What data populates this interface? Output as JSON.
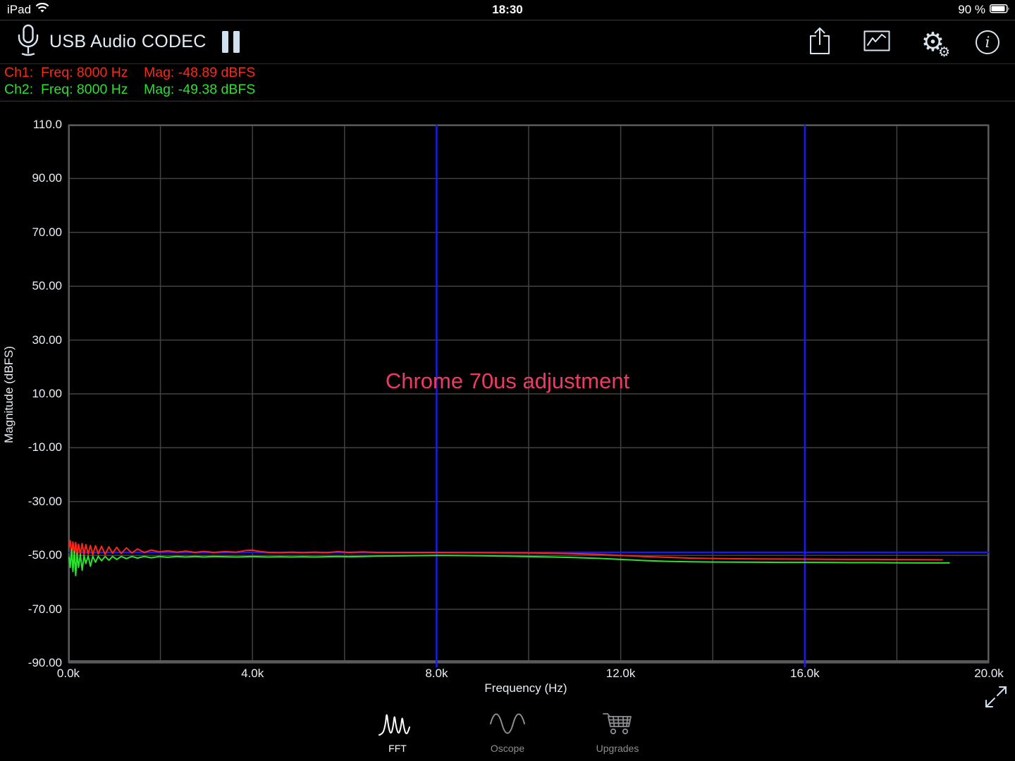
{
  "status_bar": {
    "carrier": "iPad",
    "time": "18:30",
    "battery": "90 %"
  },
  "toolbar": {
    "title": "USB Audio CODEC",
    "input_icon": "microphone-icon",
    "pause_icon": "pause-icon",
    "action_icons": [
      "share-icon",
      "chart-icon",
      "settings-gear-icon",
      "info-icon"
    ]
  },
  "readouts": [
    {
      "channel": "Ch1:",
      "freq": "Freq: 8000 Hz",
      "mag": "Mag: -48.89 dBFS",
      "color": "#fb271b"
    },
    {
      "channel": "Ch2:",
      "freq": "Freq: 8000 Hz",
      "mag": "Mag: -49.38 dBFS",
      "color": "#2ddf30"
    }
  ],
  "annotation": {
    "text": "Chrome 70us adjustment",
    "color": "#ef3a62"
  },
  "chart_data": {
    "type": "line",
    "title": "",
    "xlabel": "Frequency (Hz)",
    "ylabel": "Magnitude (dBFS)",
    "xlim": [
      0,
      20000
    ],
    "ylim": [
      -90,
      110
    ],
    "background": "#000000",
    "grid_color": "#424242",
    "border_color": "#5a5a5a",
    "tick_color": "#e9eff6",
    "x_gridlines": [
      0,
      2000,
      4000,
      6000,
      8000,
      10000,
      12000,
      14000,
      16000,
      18000,
      20000
    ],
    "y_gridlines": [
      110,
      90,
      70,
      50,
      30,
      10,
      -10,
      -30,
      -50,
      -70,
      -90
    ],
    "x_ticks": [
      {
        "value": 0,
        "label": "0.0k"
      },
      {
        "value": 4000,
        "label": "4.0k"
      },
      {
        "value": 8000,
        "label": "8.0k"
      },
      {
        "value": 12000,
        "label": "12.0k"
      },
      {
        "value": 16000,
        "label": "16.0k"
      },
      {
        "value": 20000,
        "label": "20.0k"
      }
    ],
    "y_ticks": [
      {
        "value": 110,
        "label": "110.0"
      },
      {
        "value": 90,
        "label": "90.00"
      },
      {
        "value": 70,
        "label": "70.00"
      },
      {
        "value": 50,
        "label": "50.00"
      },
      {
        "value": 30,
        "label": "30.00"
      },
      {
        "value": 10,
        "label": "10.00"
      },
      {
        "value": -10,
        "label": "-10.00"
      },
      {
        "value": -30,
        "label": "-30.00"
      },
      {
        "value": -50,
        "label": "-50.00"
      },
      {
        "value": -70,
        "label": "-70.00"
      },
      {
        "value": -90,
        "label": "-90.00"
      }
    ],
    "cursors": {
      "color": "#1b1be4",
      "vertical_hz": [
        8000,
        16000
      ],
      "horizontal_db": [
        -48.89
      ]
    },
    "series": [
      {
        "name": "Ch1",
        "color": "#fb271b",
        "points": [
          [
            15,
            -47.0
          ],
          [
            40,
            -44.5
          ],
          [
            70,
            -49.5
          ],
          [
            100,
            -45.0
          ],
          [
            130,
            -49.8
          ],
          [
            160,
            -45.2
          ],
          [
            190,
            -50.3
          ],
          [
            220,
            -45.8
          ],
          [
            260,
            -49.6
          ],
          [
            300,
            -45.6
          ],
          [
            340,
            -49.8
          ],
          [
            380,
            -46.0
          ],
          [
            430,
            -49.5
          ],
          [
            480,
            -46.3
          ],
          [
            530,
            -49.8
          ],
          [
            590,
            -46.4
          ],
          [
            650,
            -49.4
          ],
          [
            720,
            -46.6
          ],
          [
            800,
            -49.6
          ],
          [
            880,
            -46.8
          ],
          [
            960,
            -49.2
          ],
          [
            1050,
            -47.0
          ],
          [
            1150,
            -49.3
          ],
          [
            1260,
            -47.2
          ],
          [
            1380,
            -49.1
          ],
          [
            1500,
            -47.6
          ],
          [
            1650,
            -48.9
          ],
          [
            1800,
            -48.0
          ],
          [
            1980,
            -48.7
          ],
          [
            2160,
            -48.3
          ],
          [
            2350,
            -48.8
          ],
          [
            2550,
            -48.4
          ],
          [
            2750,
            -48.9
          ],
          [
            2950,
            -48.5
          ],
          [
            3150,
            -48.9
          ],
          [
            3400,
            -48.6
          ],
          [
            3650,
            -48.8
          ],
          [
            3850,
            -48.2
          ],
          [
            4000,
            -48.1
          ],
          [
            4150,
            -48.5
          ],
          [
            4350,
            -48.9
          ],
          [
            4600,
            -49.0
          ],
          [
            4850,
            -48.8
          ],
          [
            5100,
            -49.0
          ],
          [
            5350,
            -48.8
          ],
          [
            5600,
            -49.0
          ],
          [
            5850,
            -48.6
          ],
          [
            6100,
            -48.9
          ],
          [
            6400,
            -48.7
          ],
          [
            6700,
            -48.9
          ],
          [
            7100,
            -48.9
          ],
          [
            7500,
            -48.9
          ],
          [
            8000,
            -48.89
          ],
          [
            8500,
            -48.95
          ],
          [
            9000,
            -49.0
          ],
          [
            9500,
            -49.05
          ],
          [
            10000,
            -49.1
          ],
          [
            10500,
            -49.2
          ],
          [
            11000,
            -49.35
          ],
          [
            11500,
            -49.6
          ],
          [
            12000,
            -50.0
          ],
          [
            12500,
            -50.4
          ],
          [
            13000,
            -50.7
          ],
          [
            13500,
            -51.0
          ],
          [
            14000,
            -51.15
          ],
          [
            14500,
            -51.25
          ],
          [
            15000,
            -51.3
          ],
          [
            15500,
            -51.35
          ],
          [
            16000,
            -51.4
          ],
          [
            16500,
            -51.45
          ],
          [
            17000,
            -51.5
          ],
          [
            17500,
            -51.5
          ],
          [
            18000,
            -51.55
          ],
          [
            18500,
            -51.6
          ],
          [
            19000,
            -51.65
          ]
        ]
      },
      {
        "name": "Ch2",
        "color": "#2ddf30",
        "points": [
          [
            15,
            -50.5
          ],
          [
            40,
            -54.5
          ],
          [
            70,
            -47.8
          ],
          [
            100,
            -56.0
          ],
          [
            130,
            -48.5
          ],
          [
            160,
            -57.5
          ],
          [
            190,
            -49.2
          ],
          [
            220,
            -54.5
          ],
          [
            260,
            -49.6
          ],
          [
            300,
            -55.5
          ],
          [
            340,
            -50.0
          ],
          [
            380,
            -53.0
          ],
          [
            430,
            -50.2
          ],
          [
            480,
            -54.0
          ],
          [
            530,
            -50.3
          ],
          [
            590,
            -52.5
          ],
          [
            650,
            -50.3
          ],
          [
            720,
            -52.0
          ],
          [
            800,
            -50.4
          ],
          [
            880,
            -51.8
          ],
          [
            960,
            -50.4
          ],
          [
            1050,
            -51.5
          ],
          [
            1150,
            -50.4
          ],
          [
            1260,
            -51.2
          ],
          [
            1380,
            -50.4
          ],
          [
            1500,
            -51.0
          ],
          [
            1650,
            -50.4
          ],
          [
            1800,
            -50.9
          ],
          [
            1980,
            -50.4
          ],
          [
            2160,
            -50.7
          ],
          [
            2350,
            -50.4
          ],
          [
            2550,
            -50.6
          ],
          [
            2750,
            -50.4
          ],
          [
            2950,
            -50.6
          ],
          [
            3150,
            -50.4
          ],
          [
            3400,
            -50.5
          ],
          [
            3650,
            -50.6
          ],
          [
            3850,
            -50.5
          ],
          [
            4000,
            -50.4
          ],
          [
            4150,
            -50.5
          ],
          [
            4350,
            -50.6
          ],
          [
            4600,
            -50.5
          ],
          [
            4850,
            -50.6
          ],
          [
            5100,
            -50.5
          ],
          [
            5350,
            -50.6
          ],
          [
            5600,
            -50.5
          ],
          [
            5850,
            -50.4
          ],
          [
            6100,
            -50.5
          ],
          [
            6400,
            -50.4
          ],
          [
            6700,
            -50.3
          ],
          [
            7100,
            -50.2
          ],
          [
            7500,
            -50.1
          ],
          [
            8000,
            -50.0
          ],
          [
            8500,
            -50.05
          ],
          [
            9000,
            -50.15
          ],
          [
            9500,
            -50.3
          ],
          [
            10000,
            -50.45
          ],
          [
            10500,
            -50.6
          ],
          [
            11000,
            -50.8
          ],
          [
            11500,
            -51.1
          ],
          [
            12000,
            -51.5
          ],
          [
            12500,
            -51.9
          ],
          [
            13000,
            -52.2
          ],
          [
            13500,
            -52.35
          ],
          [
            14000,
            -52.45
          ],
          [
            14500,
            -52.5
          ],
          [
            15000,
            -52.55
          ],
          [
            15500,
            -52.6
          ],
          [
            16000,
            -52.6
          ],
          [
            16500,
            -52.65
          ],
          [
            17000,
            -52.7
          ],
          [
            17500,
            -52.7
          ],
          [
            18000,
            -52.75
          ],
          [
            18500,
            -52.8
          ],
          [
            19150,
            -52.8
          ]
        ]
      }
    ]
  },
  "tab_bar": {
    "tabs": [
      {
        "label": "FFT",
        "icon": "fft-spectrum-icon",
        "active": true
      },
      {
        "label": "Oscope",
        "icon": "sine-wave-icon",
        "active": false
      },
      {
        "label": "Upgrades",
        "icon": "shopping-cart-icon",
        "active": false
      }
    ]
  }
}
